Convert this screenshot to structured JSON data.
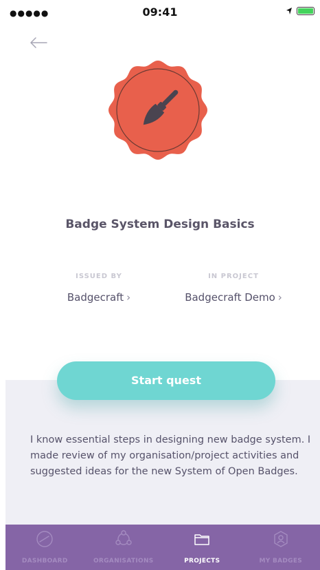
{
  "status_bar": {
    "signal": "●●●●● ",
    "time": "09:41"
  },
  "badge": {
    "title": "Badge System Design Basics",
    "icon": "paintbrush-icon",
    "color": "#e8604c"
  },
  "issued_by": {
    "label": "ISSUED BY",
    "value": "Badgecraft"
  },
  "in_project": {
    "label": "IN PROJECT",
    "value": "Badgecraft Demo"
  },
  "start_button": {
    "label": "Start quest",
    "color": "#6fd6d2"
  },
  "description": "I know essential steps in designing new badge system. I made review of my organisation/project activities and suggested ideas for the new System of Open Badges.",
  "tab_bar": {
    "color": "#8565a6",
    "tabs": [
      {
        "label": "DASHBOARD",
        "icon": "dashboard-icon",
        "active": false
      },
      {
        "label": "ORGANISATIONS",
        "icon": "organisations-icon",
        "active": false
      },
      {
        "label": "PROJECTS",
        "icon": "folder-icon",
        "active": true
      },
      {
        "label": "MY BADGES",
        "icon": "my-badges-icon",
        "active": false
      }
    ]
  }
}
